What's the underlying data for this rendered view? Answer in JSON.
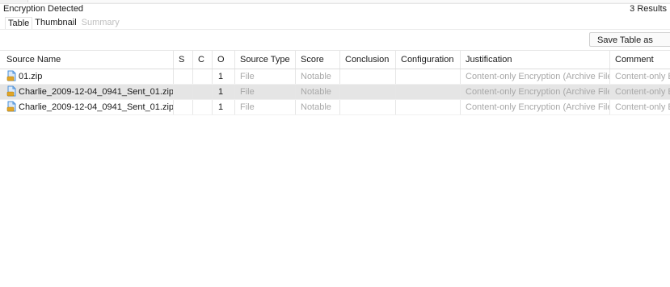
{
  "header": {
    "title": "Encryption Detected",
    "results": "3  Results"
  },
  "tabs": [
    {
      "label": "Table",
      "state": "active"
    },
    {
      "label": "Thumbnail",
      "state": "normal"
    },
    {
      "label": "Summary",
      "state": "disabled"
    }
  ],
  "toolbar": {
    "save_label": "Save Table as CSV"
  },
  "table": {
    "columns": [
      "Source Name",
      "S",
      "C",
      "O",
      "Source Type",
      "Score",
      "Conclusion",
      "Configuration",
      "Justification",
      "Comment"
    ],
    "rows": [
      {
        "name": "01.zip",
        "s": "",
        "c": "",
        "o": "1",
        "source_type": "File",
        "score": "Notable",
        "conclusion": "",
        "configuration": "",
        "justification": "Content-only Encryption (Archive File)",
        "comment": "Content-only Encryption (Archive File)",
        "selected": false,
        "icon": "file-zip-icon"
      },
      {
        "name": "Charlie_2009-12-04_0941_Sent_01.zip",
        "s": "",
        "c": "",
        "o": "1",
        "source_type": "File",
        "score": "Notable",
        "conclusion": "",
        "configuration": "",
        "justification": "Content-only Encryption (Archive File)",
        "comment": "Content-only Encryption (Archive File)",
        "selected": true,
        "icon": "file-zip-icon"
      },
      {
        "name": "Charlie_2009-12-04_0941_Sent_01.zip",
        "s": "",
        "c": "",
        "o": "1",
        "source_type": "File",
        "score": "Notable",
        "conclusion": "",
        "configuration": "",
        "justification": "Content-only Encryption (Archive File)",
        "comment": "Content-only Encryption (Archive File)",
        "selected": false,
        "icon": "file-zip-icon"
      }
    ]
  },
  "colors": {
    "selected_row": "#e5e5e5",
    "muted_text": "#a8a8a8",
    "icon_blue": "#4a90d9",
    "icon_gold": "#e0a526"
  }
}
